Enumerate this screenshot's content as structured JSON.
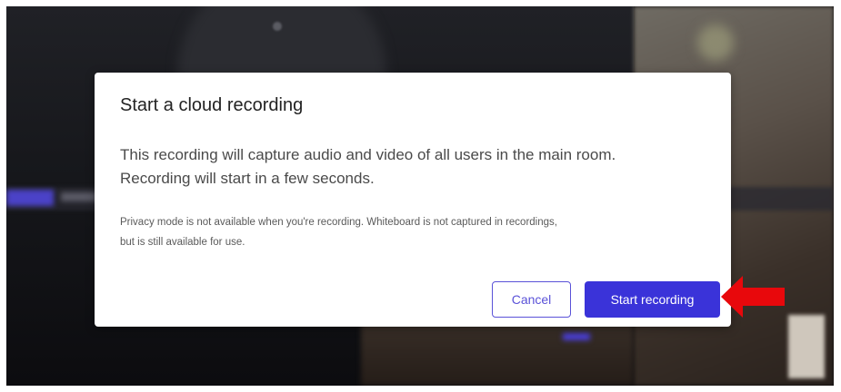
{
  "dialog": {
    "title": "Start a cloud recording",
    "body_line1": "This recording will capture audio and video of all users in the main room.",
    "body_line2": "Recording will start in a few seconds.",
    "note_line1": "Privacy mode is not available when you're recording. Whiteboard is not captured in recordings,",
    "note_line2": "but is still available for use.",
    "cancel_label": "Cancel",
    "start_label": "Start recording"
  },
  "colors": {
    "accent": "#3a33d9",
    "cancel_border": "#5a52d8",
    "annotation": "#e8080c"
  },
  "annotation": {
    "icon": "red-arrow-icon",
    "points_to": "start-recording-button"
  }
}
